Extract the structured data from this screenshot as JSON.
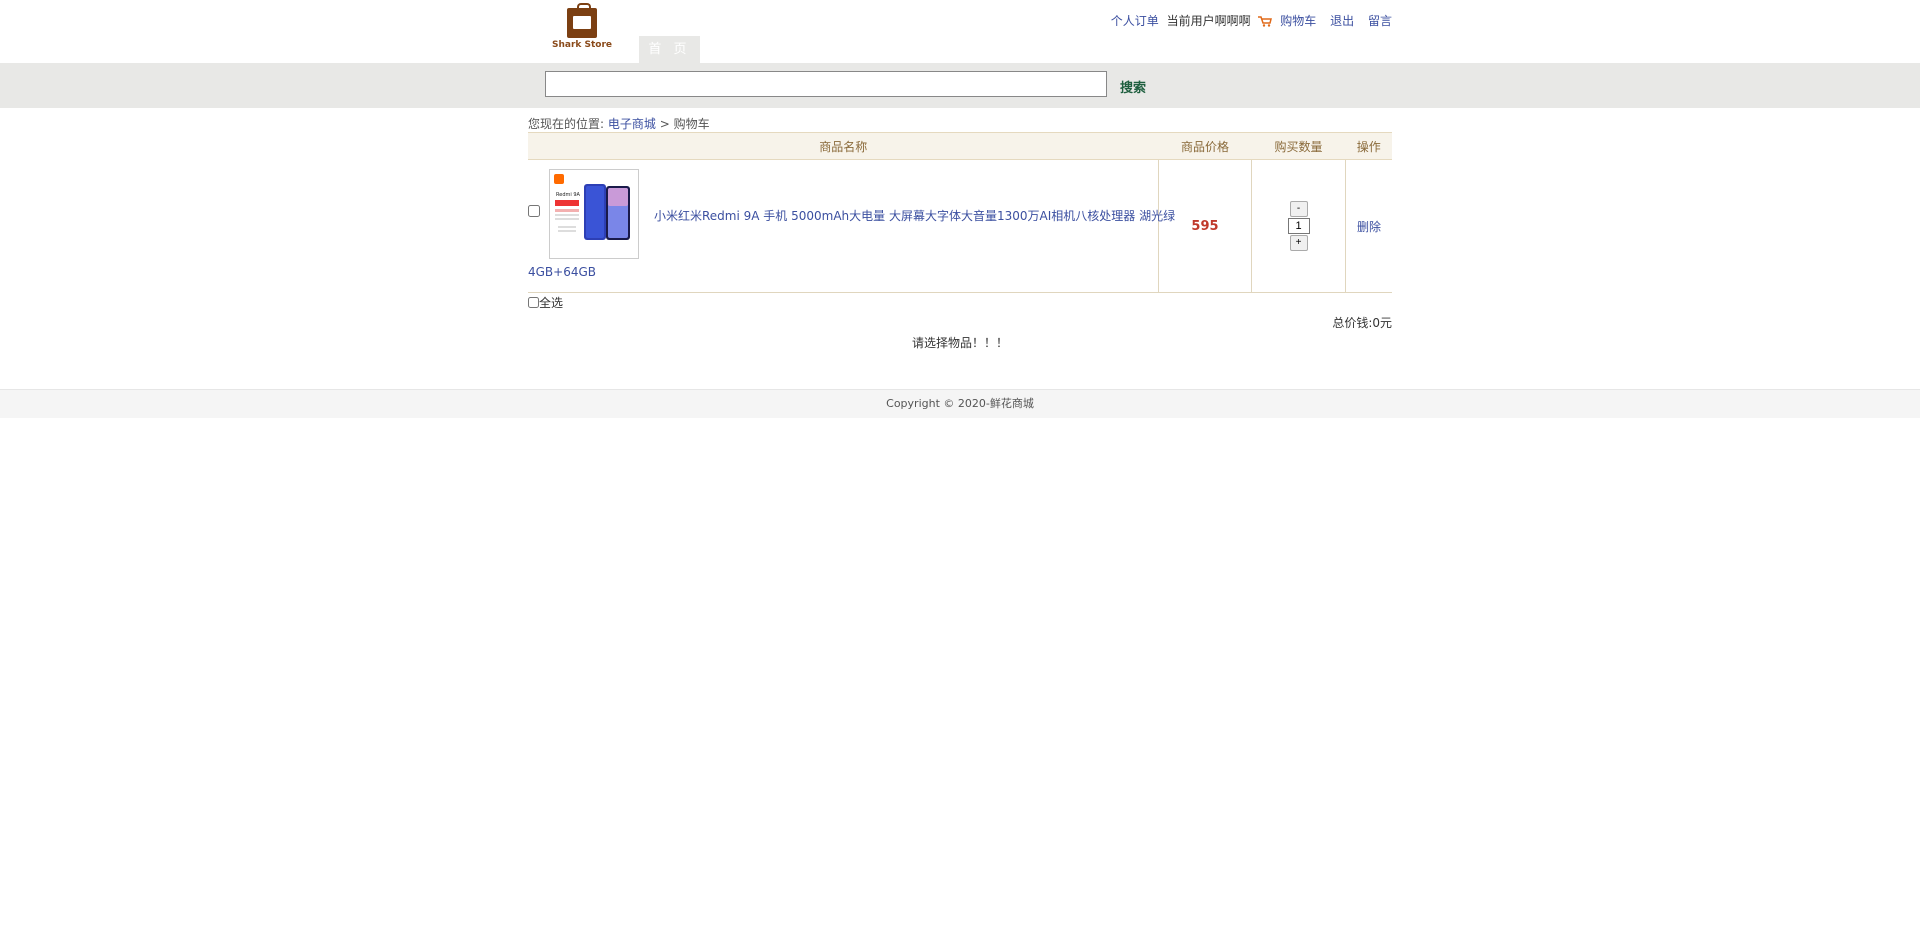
{
  "header": {
    "logo_text": "Shark Store",
    "nav_home": "首 页",
    "links": {
      "orders": "个人订单",
      "current_user": "当前用户啊啊啊",
      "cart": "购物车",
      "logout": "退出",
      "message": "留言"
    }
  },
  "search": {
    "value": "",
    "button": "搜索"
  },
  "breadcrumb": {
    "prefix": "您现在的位置:",
    "home": "电子商城",
    "separator": ">",
    "current": "购物车"
  },
  "cart": {
    "columns": [
      "商品名称",
      "商品价格",
      "购买数量",
      "操作"
    ],
    "items": [
      {
        "name_line1": "小米红米Redmi 9A 手机 5000mAh大电量 大屏幕大字体大音量1300万AI相机八核处理器 湖光绿",
        "name_line2": "4GB+64GB",
        "price": "595",
        "qty_minus": "-",
        "quantity": "1",
        "qty_plus": "+",
        "action": "删除",
        "thumb_brand": "Redmi 9A"
      }
    ],
    "select_all": "全选",
    "total": "总价钱:0元",
    "notice": "请选择物品！！！"
  },
  "footer": {
    "copyright": "Copyright © 2020-鲜花商城"
  },
  "colors": {
    "accent_link": "#3b4fa0",
    "price": "#c0392b",
    "header_band": "#e8e8e6",
    "table_head_bg": "#f7f3ea",
    "logo": "#7b3f12"
  }
}
